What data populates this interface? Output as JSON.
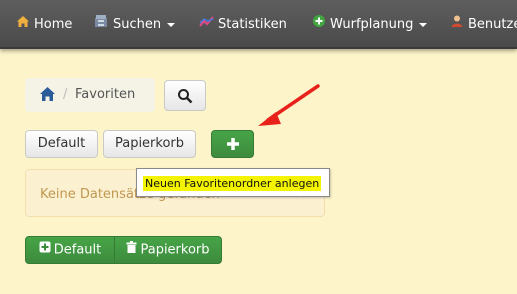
{
  "navbar": {
    "items": [
      {
        "label": "Home",
        "icon": "home-icon"
      },
      {
        "label": "Suchen",
        "icon": "search-cabinet-icon",
        "dropdown": true
      },
      {
        "label": "Statistiken",
        "icon": "chart-icon"
      },
      {
        "label": "Wurfplanung",
        "icon": "plus-circle-icon",
        "dropdown": true
      },
      {
        "label": "Benutze",
        "icon": "user-icon"
      }
    ]
  },
  "breadcrumb": {
    "current": "Favoriten",
    "separator": "/"
  },
  "toolbar": {
    "default_label": "Default",
    "trash_label": "Papierkorb",
    "add_icon": "plus-icon"
  },
  "alert": {
    "text": "Keine Datensätze gefunden",
    "close": "×"
  },
  "tooltip": {
    "text": "Neuen Favoritenordner anlegen"
  },
  "button_group": {
    "default_label": "Default",
    "trash_label": "Papierkorb"
  },
  "colors": {
    "navbar": "#505050",
    "success": "#42a142",
    "background": "#fdf5c9",
    "arrow": "#e8211b",
    "highlight": "#f4f400"
  }
}
